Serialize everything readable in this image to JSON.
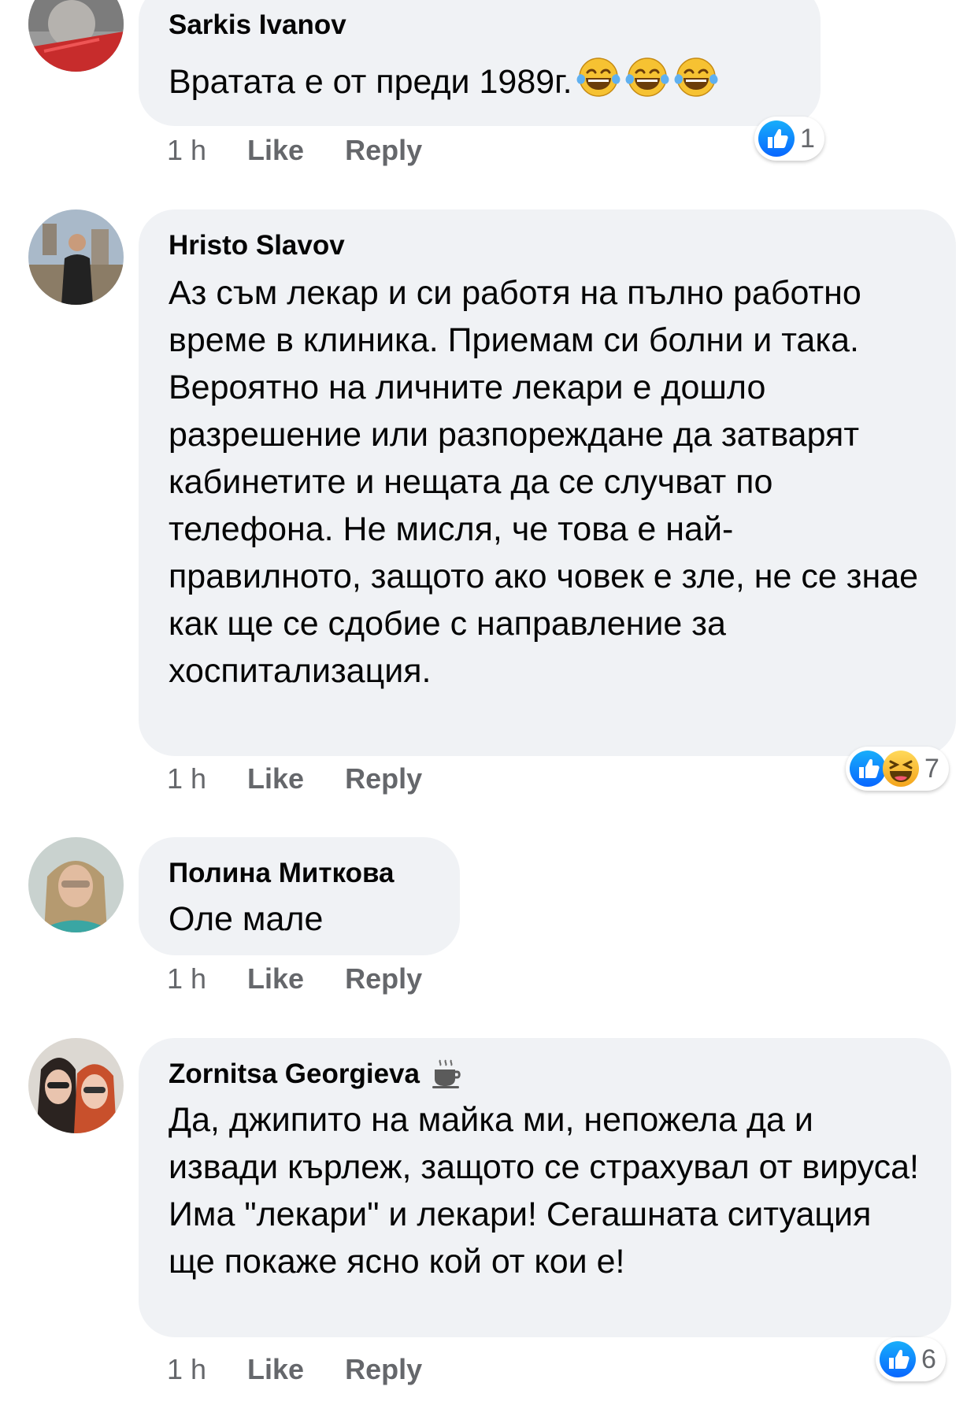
{
  "comments": [
    {
      "author": "Sarkis Ivanov",
      "text": "Вратата е от преди 1989г.",
      "emojis": [
        "laughing-tears",
        "laughing-tears",
        "laughing-tears"
      ],
      "time": "1 h",
      "like_label": "Like",
      "reply_label": "Reply",
      "reaction_count": "1",
      "reactions": [
        "like"
      ]
    },
    {
      "author": "Hristo Slavov",
      "text": "Аз съм лекар и си работя на пълно работно време в клиника. Приемам си болни и така. Вероятно на личните лекари е дошло разрешение или разпореждане да затварят кабинетите и нещата да се случват по телефона. Не мисля, че това е най-правилното, защото ако човек е зле, не се знае как ще се сдобие с направление за хоспитализация.",
      "time": "1 h",
      "like_label": "Like",
      "reply_label": "Reply",
      "reaction_count": "7",
      "reactions": [
        "like",
        "haha"
      ]
    },
    {
      "author": "Полина Миткова",
      "text": "Оле мале",
      "time": "1 h",
      "like_label": "Like",
      "reply_label": "Reply"
    },
    {
      "author": "Zornitsa Georgieva",
      "author_badge": "coffee-icon",
      "text": "Да, джипито на майка ми, непожела да и извади кърлеж, защото се страхувал от вируса! Има \"лекари\" и лекари! Сегашната ситуация ще покаже ясно кой от кои е!",
      "time": "1 h",
      "like_label": "Like",
      "reply_label": "Reply",
      "reaction_count": "6",
      "reactions": [
        "like"
      ]
    }
  ],
  "colors": {
    "bubble": "#f0f2f5",
    "meta": "#65676b",
    "like_blue": "#1877f2",
    "haha_yellow": "#f7b125"
  }
}
